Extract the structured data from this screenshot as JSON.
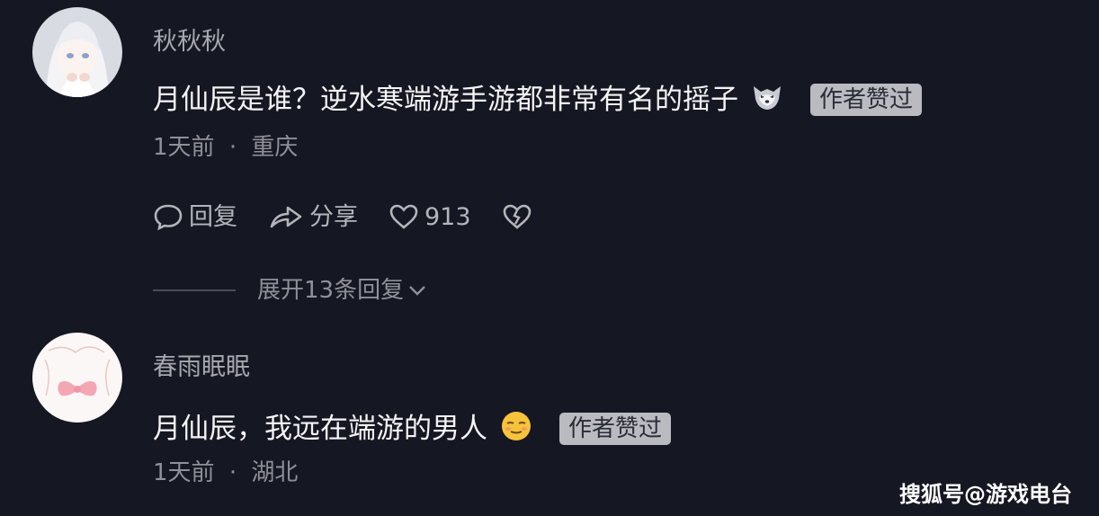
{
  "comments": [
    {
      "username": "秋秋秋",
      "text": "月仙辰是谁？逆水寒端游手游都非常有名的摇子",
      "emoji_icon": "wolf-face-icon",
      "badge": "作者赞过",
      "time": "1天前",
      "location": "重庆",
      "actions": {
        "reply_label": "回复",
        "share_label": "分享",
        "like_count": "913"
      },
      "expand_label": "展开13条回复"
    },
    {
      "username": "春雨眠眠",
      "text": "月仙辰，我远在端游的男人",
      "emoji_icon": "relieved-face-icon",
      "badge": "作者赞过",
      "time": "1天前",
      "location": "湖北"
    }
  ],
  "meta_separator": "·",
  "watermark": "搜狐号@游戏电台",
  "colors": {
    "background": "#151722",
    "username": "#a7a8ae",
    "body_text": "#f4f4f6",
    "meta_text": "#8f9098",
    "badge_bg": "#b9bbc1"
  }
}
